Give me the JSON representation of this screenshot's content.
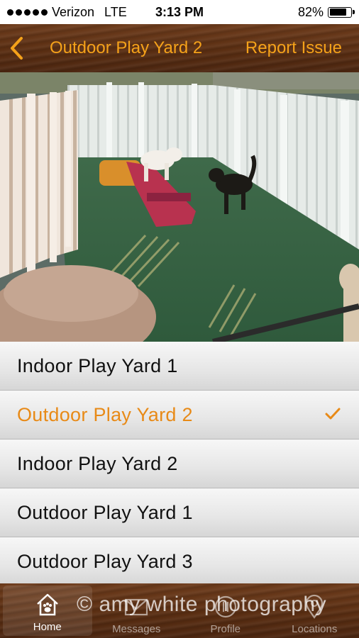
{
  "status_bar": {
    "carrier": "Verizon",
    "network": "LTE",
    "time": "3:13 PM",
    "battery_text": "82%",
    "battery_level": 0.82
  },
  "nav": {
    "title": "Outdoor Play Yard 2",
    "action_label": "Report Issue",
    "accent_color": "#f5a21a"
  },
  "camera": {
    "icon": "camera-feed-image"
  },
  "yards": {
    "items": [
      {
        "label": "Indoor Play Yard 1",
        "selected": false
      },
      {
        "label": "Outdoor Play Yard 2",
        "selected": true
      },
      {
        "label": "Indoor Play Yard 2",
        "selected": false
      },
      {
        "label": "Outdoor Play Yard 1",
        "selected": false
      },
      {
        "label": "Outdoor Play Yard 3",
        "selected": false
      }
    ],
    "selected_color": "#e88a17"
  },
  "tabs": [
    {
      "label": "Home",
      "icon": "paw-house-icon",
      "active": true
    },
    {
      "label": "Messages",
      "icon": "envelope-icon",
      "active": false
    },
    {
      "label": "Profile",
      "icon": "profile-icon",
      "active": false
    },
    {
      "label": "Locations",
      "icon": "map-pin-icon",
      "active": false
    }
  ],
  "watermark": "© amy white photography"
}
